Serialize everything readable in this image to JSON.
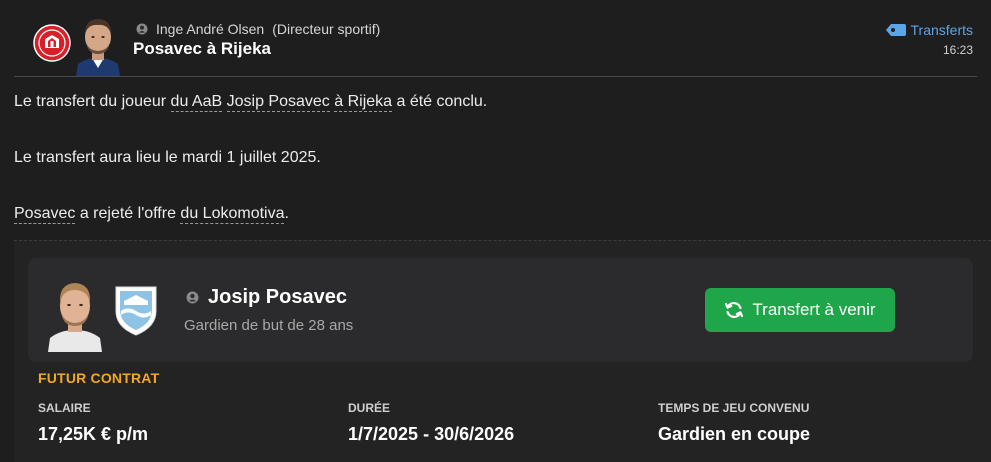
{
  "header": {
    "sender_name": "Inge André Olsen",
    "sender_role": "(Directeur sportif)",
    "title": "Posavec à Rijeka",
    "category": "Transferts",
    "time": "16:23",
    "club_logo_icon": "aab-crest-icon",
    "category_icon": "tag-icon"
  },
  "message": {
    "p1": {
      "before": "Le transfert du joueur ",
      "club_link": "du AaB",
      "player_link": "Josip Posavec",
      "dest_link": "à Rijeka",
      "after": " a été conclu."
    },
    "p2": "Le transfert aura lieu le mardi 1 juillet 2025.",
    "p3": {
      "player_link": "Posavec",
      "middle": " a rejeté l'offre ",
      "club_link": "du Lokomotiva",
      "after": "."
    }
  },
  "card": {
    "player_name": "Josip Posavec",
    "player_description": "Gardien de but de 28 ans",
    "status_button": "Transfert à venir",
    "status_color": "#1fa64a",
    "club_badge_icon": "rijeka-crest-icon"
  },
  "contract": {
    "section_title": "FUTUR CONTRAT",
    "accent_color": "#f5a623",
    "salary_label": "SALAIRE",
    "salary_value": "17,25K € p/m",
    "duration_label": "DURÉE",
    "duration_value": "1/7/2025 - 30/6/2026",
    "playing_time_label": "TEMPS DE JEU CONVENU",
    "playing_time_value": "Gardien en coupe"
  }
}
